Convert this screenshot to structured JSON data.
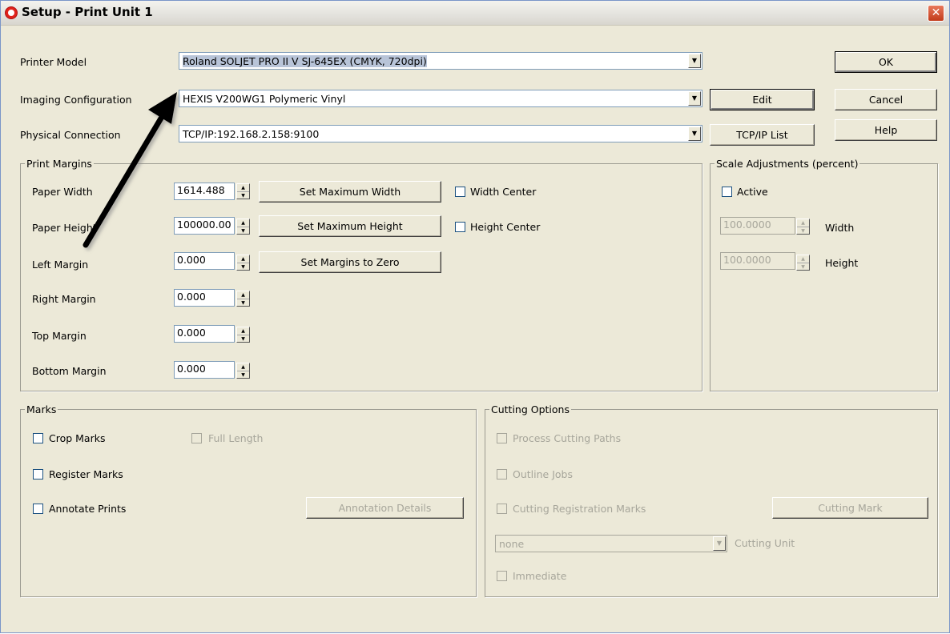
{
  "window": {
    "title": "Setup - Print Unit 1",
    "close_icon": "close-icon"
  },
  "top": {
    "printer_model_label": "Printer Model",
    "printer_model_value": "Roland  SOLJET PRO II V SJ-645EX (CMYK, 720dpi)",
    "imaging_label": "Imaging Configuration",
    "imaging_value": "HEXIS V200WG1 Polymeric Vinyl",
    "connection_label": "Physical Connection",
    "connection_value": "TCP/IP:192.168.2.158:9100"
  },
  "buttons": {
    "ok": "OK",
    "cancel": "Cancel",
    "help": "Help",
    "edit": "Edit",
    "tcpip_list": "TCP/IP List"
  },
  "print_margins": {
    "title": "Print Margins",
    "paper_width_label": "Paper Width",
    "paper_width_value": "1614.488",
    "set_max_width": "Set Maximum Width",
    "width_center": "Width Center",
    "paper_height_label": "Paper Height",
    "paper_height_value": "100000.00",
    "set_max_height": "Set Maximum Height",
    "height_center": "Height Center",
    "left_margin_label": "Left Margin",
    "left_margin_value": "0.000",
    "set_margins_zero": "Set Margins to Zero",
    "right_margin_label": "Right Margin",
    "right_margin_value": "0.000",
    "top_margin_label": "Top Margin",
    "top_margin_value": "0.000",
    "bottom_margin_label": "Bottom Margin",
    "bottom_margin_value": "0.000"
  },
  "scale": {
    "title": "Scale Adjustments (percent)",
    "active": "Active",
    "width_value": "100.0000",
    "width_label": "Width",
    "height_value": "100.0000",
    "height_label": "Height"
  },
  "marks": {
    "title": "Marks",
    "crop_marks": "Crop Marks",
    "full_length": "Full Length",
    "register_marks": "Register Marks",
    "annotate_prints": "Annotate Prints",
    "annotation_details": "Annotation Details"
  },
  "cutting": {
    "title": "Cutting Options",
    "process_paths": "Process Cutting Paths",
    "outline_jobs": "Outline Jobs",
    "registration_marks": "Cutting Registration Marks",
    "cutting_mark": "Cutting Mark",
    "unit_value": "none",
    "unit_label": "Cutting Unit",
    "immediate": "Immediate"
  }
}
